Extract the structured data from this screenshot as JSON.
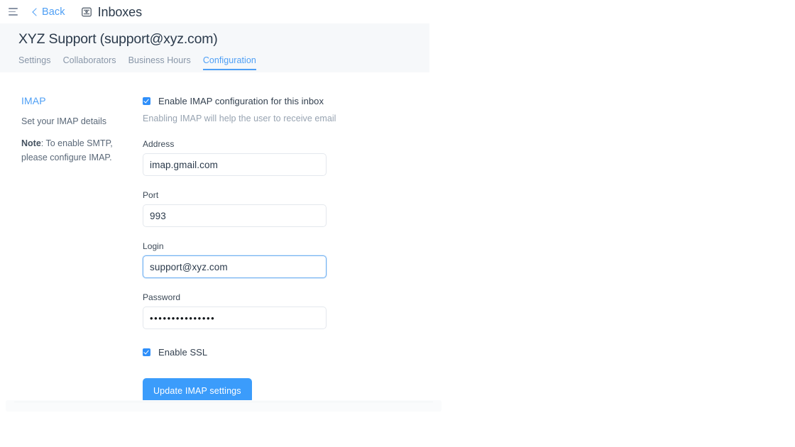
{
  "topbar": {
    "menu_icon": "hamburger-menu-icon",
    "back_label": "Back",
    "back_chevron_icon": "chevron-left-icon",
    "inbox_icon": "inbox-icon",
    "heading": "Inboxes"
  },
  "header": {
    "title": "XYZ Support (support@xyz.com)",
    "tabs": [
      {
        "label": "Settings",
        "active": false
      },
      {
        "label": "Collaborators",
        "active": false
      },
      {
        "label": "Business Hours",
        "active": false
      },
      {
        "label": "Configuration",
        "active": true
      }
    ]
  },
  "sidebar": {
    "title": "IMAP",
    "subtitle": "Set your IMAP details",
    "note_label": "Note",
    "note_text": ": To enable SMTP, please configure IMAP."
  },
  "form": {
    "enable_checkbox": {
      "label": "Enable IMAP configuration for this inbox",
      "checked": true
    },
    "helper_text": "Enabling IMAP will help the user to receive email",
    "fields": [
      {
        "label": "Address",
        "value": "imap.gmail.com",
        "placeholder": "Address",
        "focused": false,
        "type": "text"
      },
      {
        "label": "Port",
        "value": "993",
        "placeholder": "Port",
        "focused": false,
        "type": "text"
      },
      {
        "label": "Login",
        "value": "support@xyz.com",
        "placeholder": "Login",
        "focused": true,
        "type": "text"
      },
      {
        "label": "Password",
        "value": "•••••••••••••••",
        "placeholder": "Password",
        "focused": false,
        "type": "password"
      }
    ],
    "ssl_checkbox": {
      "label": "Enable SSL",
      "checked": true
    },
    "submit_label": "Update IMAP settings"
  },
  "colors": {
    "accent": "#4e9ff5",
    "button": "#3b9cfb",
    "checkbox": "#2f8ffa",
    "header_panel": "#f6f8fa",
    "text": "#2b3a4b",
    "muted": "#8896a8"
  }
}
